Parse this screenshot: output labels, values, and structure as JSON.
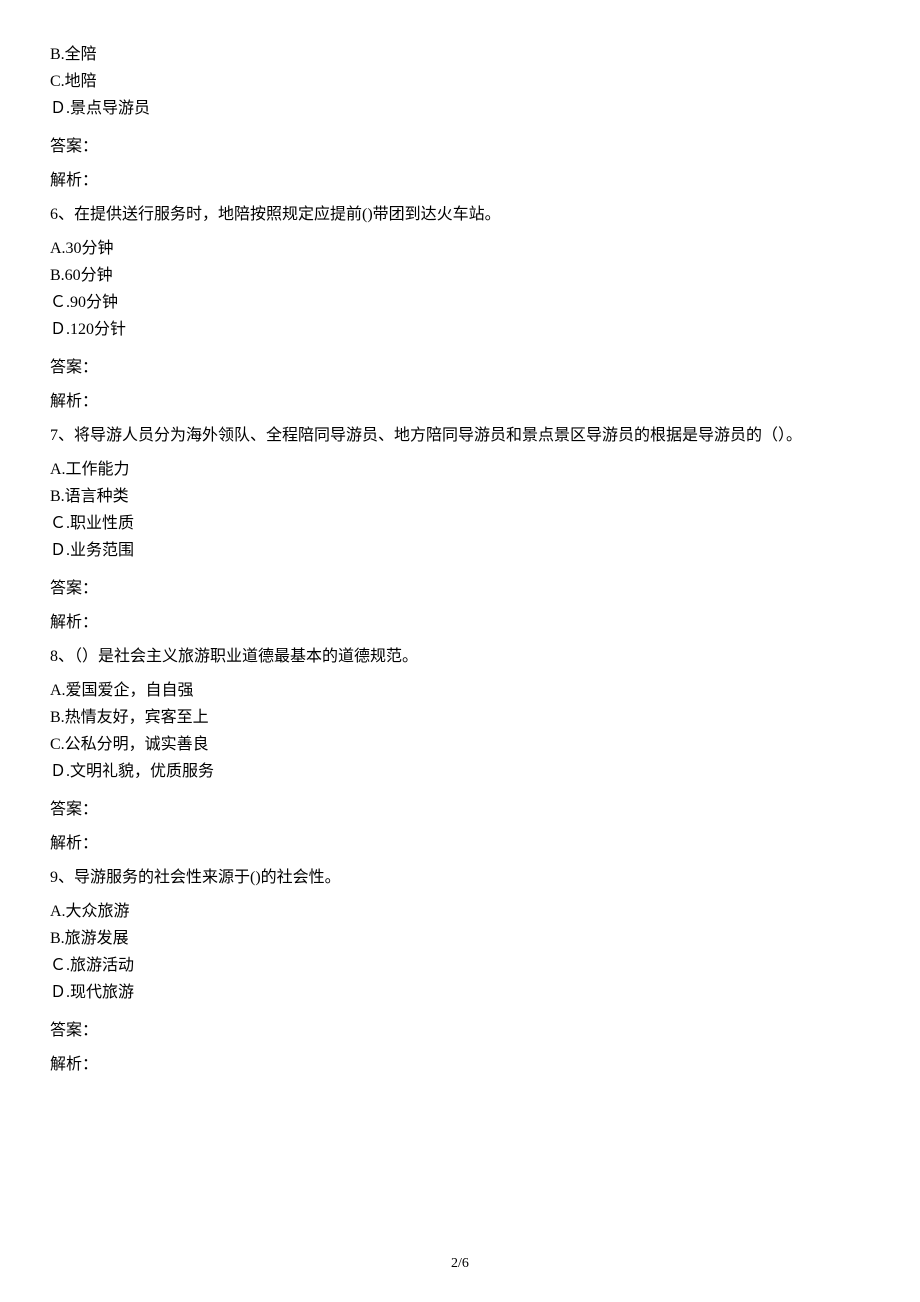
{
  "q5_partial": {
    "options": [
      "B.全陪",
      "C.地陪",
      "Ｄ.景点导游员"
    ],
    "answer_label": "答案：",
    "analysis_label": "解析："
  },
  "q6": {
    "stem": "6、在提供送行服务时，地陪按照规定应提前()带团到达火车站。",
    "options": [
      "A.30分钟",
      "B.60分钟",
      "Ｃ.90分钟",
      "Ｄ.120分针"
    ],
    "answer_label": "答案：",
    "analysis_label": "解析："
  },
  "q7": {
    "stem": "7、将导游人员分为海外领队、全程陪同导游员、地方陪同导游员和景点景区导游员的根据是导游员的（）。",
    "options": [
      "A.工作能力",
      "B.语言种类",
      "Ｃ.职业性质",
      "Ｄ.业务范围"
    ],
    "answer_label": "答案：",
    "analysis_label": "解析："
  },
  "q8": {
    "stem": "8、（）是社会主义旅游职业道德最基本的道德规范。",
    "options": [
      "A.爱国爱企，自自强",
      "B.热情友好，宾客至上",
      "C.公私分明，诚实善良",
      "Ｄ.文明礼貌，优质服务"
    ],
    "answer_label": "答案：",
    "analysis_label": "解析："
  },
  "q9": {
    "stem": "9、导游服务的社会性来源于()的社会性。",
    "options": [
      "A.大众旅游",
      "B.旅游发展",
      "Ｃ.旅游活动",
      "Ｄ.现代旅游"
    ],
    "answer_label": "答案：",
    "analysis_label": "解析："
  },
  "page_number": "2/6"
}
